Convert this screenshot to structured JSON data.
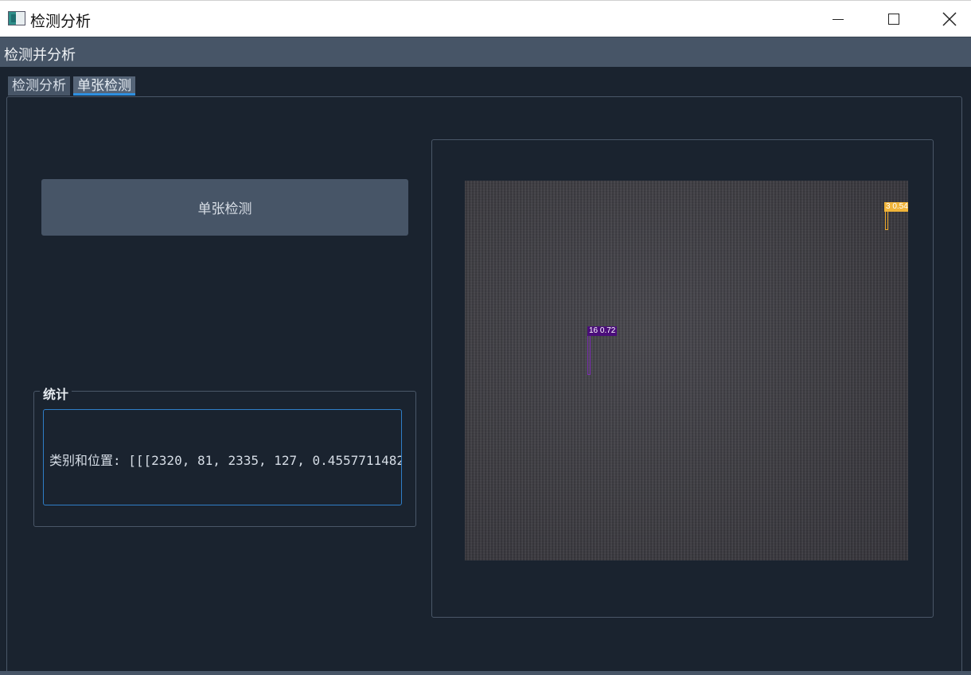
{
  "window": {
    "title": "检测分析"
  },
  "menubar": {
    "item": "检测并分析"
  },
  "tabs": [
    {
      "label": "检测分析"
    },
    {
      "label": "单张检测"
    }
  ],
  "actions": {
    "single_detect_label": "单张检测"
  },
  "stats": {
    "title": "统计",
    "text": "类别和位置: [[[2320, 81, 2335, 127, 0.4557711482"
  },
  "detections": [
    {
      "label": "16 0.72",
      "color": "#4a0d7a"
    },
    {
      "label": "3 0.54",
      "color": "#f0b43a"
    }
  ],
  "icons": {
    "app": "app-icon",
    "minimize": "minimize-icon",
    "maximize": "maximize-icon",
    "close": "close-icon"
  }
}
